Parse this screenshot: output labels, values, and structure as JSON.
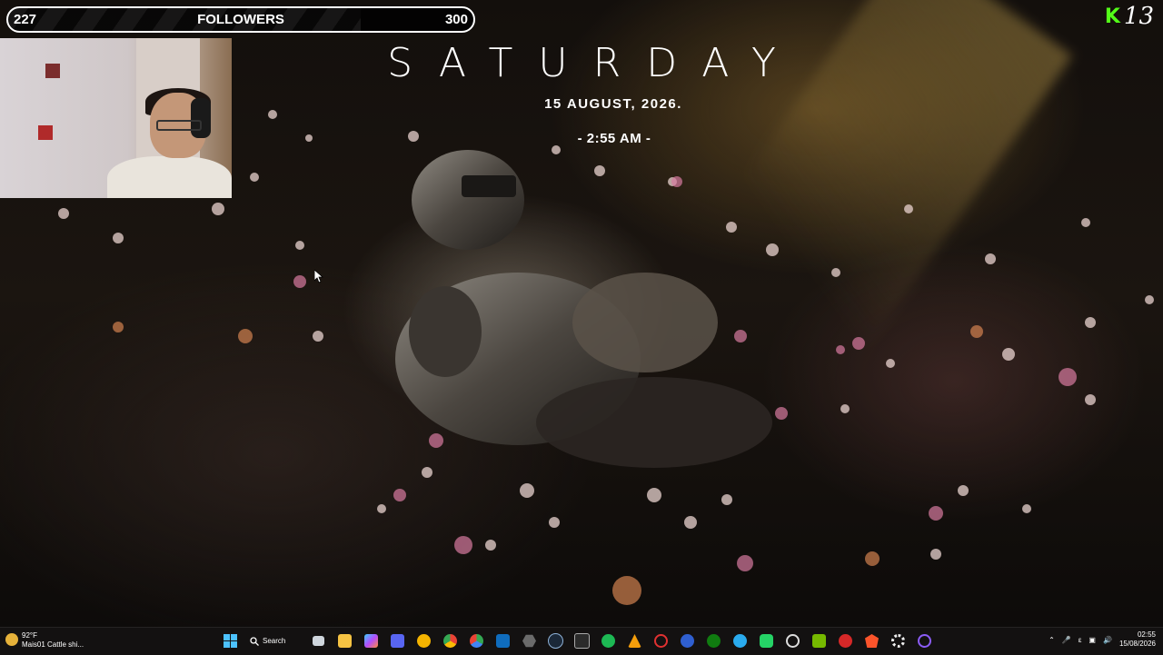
{
  "follower_goal": {
    "current": "227",
    "label": "FOLLOWERS",
    "goal": "300",
    "progress": 0.757
  },
  "branding": {
    "logo_text": "K",
    "number": "13"
  },
  "datetime_widget": {
    "day": "SATURDAY",
    "date": "15  AUGUST, 2026.",
    "time": "- 2:55 AM -"
  },
  "taskbar": {
    "weather": {
      "temp": "92°F",
      "user": "Mais01",
      "condition": "Cattle shi..."
    },
    "search_label": "Search",
    "apps": [
      "windows-start",
      "search",
      "task-view",
      "file-explorer",
      "copilot",
      "discord",
      "app-yellow",
      "chrome",
      "chrome-alt",
      "outlook",
      "app-hex",
      "steam",
      "app-terminal",
      "spotify",
      "app-orange",
      "app-red-ring",
      "app-blue",
      "xbox",
      "telegram",
      "whatsapp",
      "app-circle",
      "nvidia",
      "app-red",
      "brave",
      "settings",
      "app-purple"
    ],
    "tray_letter": "ε",
    "clock_time": "02:55",
    "clock_date": "15/08/2026"
  },
  "colors": {
    "kick_green": "#53fc18",
    "taskbar": "#141212"
  }
}
